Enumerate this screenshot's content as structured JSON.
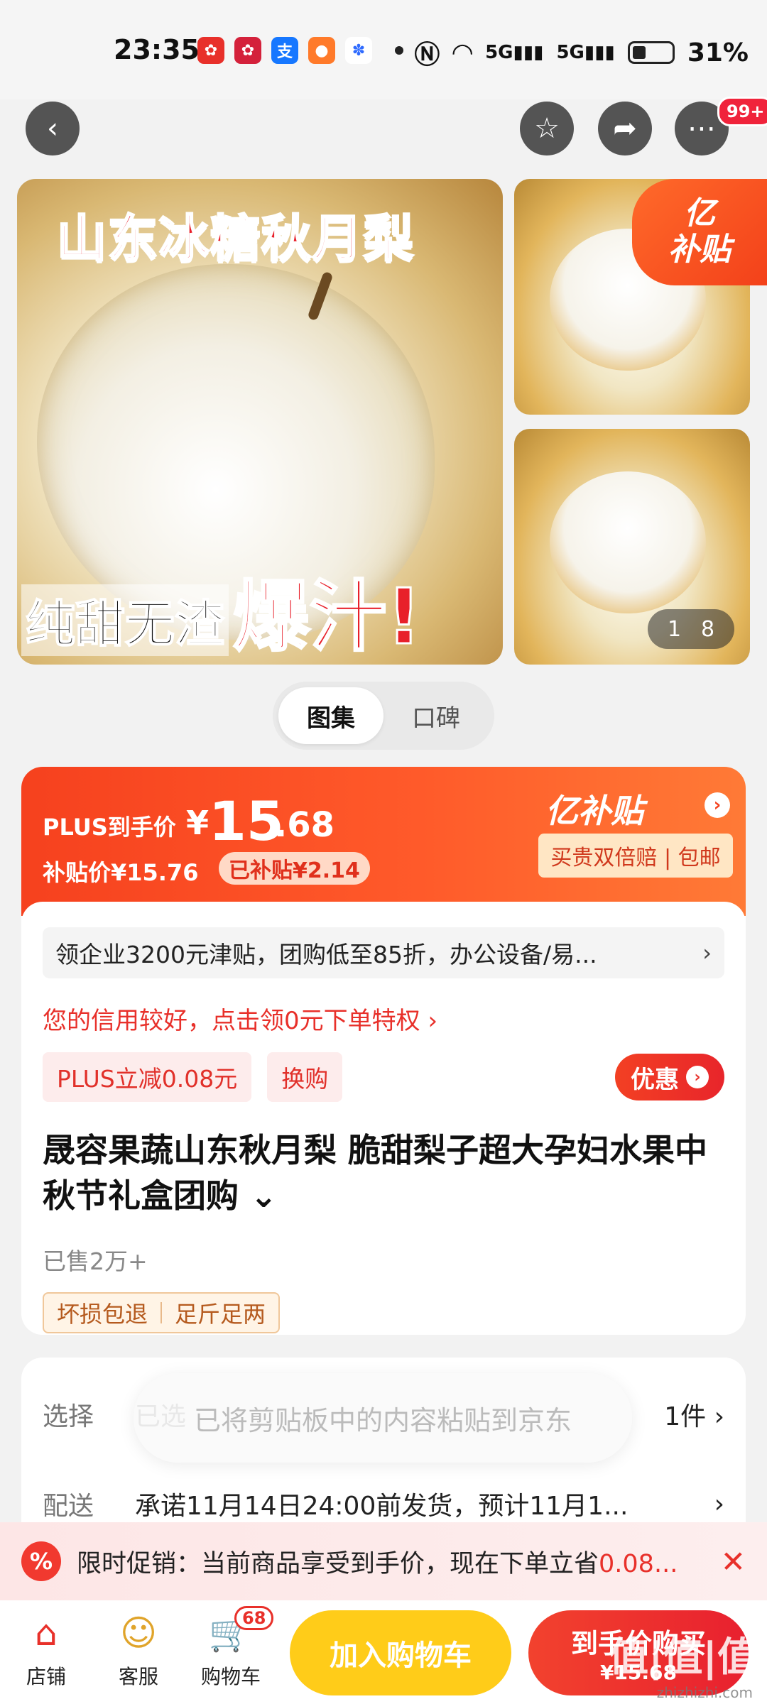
{
  "status_bar": {
    "time": "23:35",
    "network_labels": [
      "5G",
      "5G"
    ],
    "battery": "31%"
  },
  "gallery": {
    "banner_top": "山东冰糖秋月梨",
    "banner_bottom_left": "纯甜无渣",
    "banner_bottom_right": "爆汁!",
    "badge_line1": "亿",
    "badge_line2": "补贴",
    "counter_current": "1",
    "counter_total": "8"
  },
  "nav": {
    "more_badge": "99+"
  },
  "segment": {
    "tabs": [
      "图集",
      "口碑"
    ],
    "active": 0
  },
  "price": {
    "plus_label": "PLUS到手价",
    "currency": "¥",
    "plus_price_int": "15",
    "plus_price_dec": ".68",
    "subsidy_price": "补贴价¥15.76",
    "subsidized_chip": "已补贴¥2.14",
    "yi_tag": "亿补贴",
    "guarantee": "买贵双倍赔 | 包邮"
  },
  "body": {
    "coupon_text": "领企业3200元津贴，团购低至85折，办公设备/易...",
    "credit_text": "您的信用较好，点击领0元下单特权 ›",
    "tags": [
      "PLUS立减0.08元",
      "换购"
    ],
    "youhui_label": "优惠",
    "product_title": "晟容果蔬山东秋月梨 脆甜梨子超大孕妇水果中秋节礼盒团购",
    "sold": "已售2万+",
    "guarantees": [
      "坏损包退",
      "足斤足两"
    ]
  },
  "options": {
    "select_key": "选择",
    "select_value": "已选",
    "select_right": "1件 ›",
    "ship_key": "配送",
    "ship_value": "承诺11月14日24:00前发货，预计11月1...",
    "ship_right": "›"
  },
  "toast": "已将剪贴板中的内容粘贴到京东",
  "promo": {
    "text_prefix": "限时促销：当前商品享受到手价，现在下单立省",
    "text_amount": "0.08...",
    "close": "✕"
  },
  "bottom": {
    "shop": "店铺",
    "service": "客服",
    "cart": "购物车",
    "cart_count": "68",
    "add_cart": "加入购物车",
    "buy": "到手价购买",
    "buy_price": "¥15.68",
    "watermark": "值|值|值",
    "watermark_sub": "zhizhizhi.com"
  },
  "colors": {
    "accent_red": "#e8302a",
    "accent_orange": "#f6411e",
    "cart_yellow": "#ffcc19"
  }
}
